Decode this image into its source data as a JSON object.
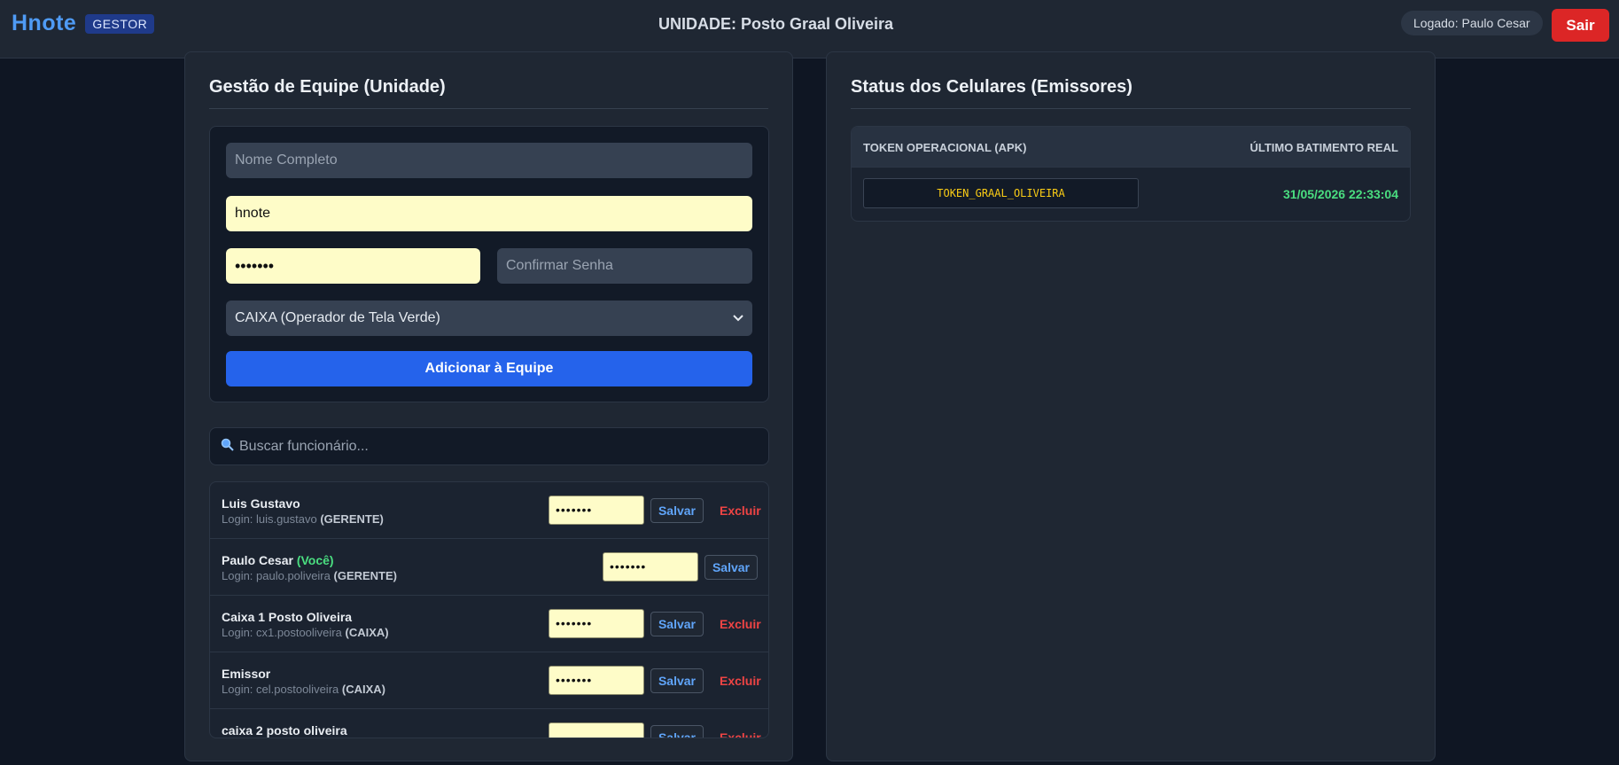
{
  "header": {
    "brand": "Hnote",
    "badge": "GESTOR",
    "unit_title": "UNIDADE: Posto Graal Oliveira",
    "logged_user": "Logado: Paulo Cesar",
    "logout_label": "Sair"
  },
  "team": {
    "title": "Gestão de Equipe (Unidade)",
    "form": {
      "name_placeholder": "Nome Completo",
      "login_value": "hnote",
      "password_value": "•••••••",
      "confirm_placeholder": "Confirmar Senha",
      "role_selected": "CAIXA (Operador de Tela Verde)",
      "add_label": "Adicionar à Equipe"
    },
    "search_placeholder": "Buscar funcionário...",
    "employees": [
      {
        "name": "Luis Gustavo",
        "you": "",
        "login": "Login: luis.gustavo",
        "role": "(GERENTE)",
        "password": "•••••••",
        "save": "Salvar",
        "delete": "Excluir"
      },
      {
        "name": "Paulo Cesar",
        "you": "(Você)",
        "login": "Login: paulo.poliveira",
        "role": "(GERENTE)",
        "password": "•••••••",
        "save": "Salvar",
        "delete": ""
      },
      {
        "name": "Caixa 1 Posto Oliveira",
        "you": "",
        "login": "Login: cx1.postooliveira",
        "role": "(CAIXA)",
        "password": "•••••••",
        "save": "Salvar",
        "delete": "Excluir"
      },
      {
        "name": "Emissor",
        "you": "",
        "login": "Login: cel.postooliveira",
        "role": "(CAIXA)",
        "password": "•••••••",
        "save": "Salvar",
        "delete": "Excluir"
      },
      {
        "name": "caixa 2 posto oliveira",
        "you": "",
        "login": "",
        "role": "",
        "password": "",
        "save": "Salvar",
        "delete": "Excluir"
      }
    ]
  },
  "status": {
    "title": "Status dos Celulares (Emissores)",
    "col_token": "TOKEN OPERACIONAL (APK)",
    "col_beat": "ÚLTIMO BATIMENTO REAL",
    "token": "TOKEN_GRAAL_OLIVEIRA",
    "beat": "31/05/2026 22:33:04"
  }
}
